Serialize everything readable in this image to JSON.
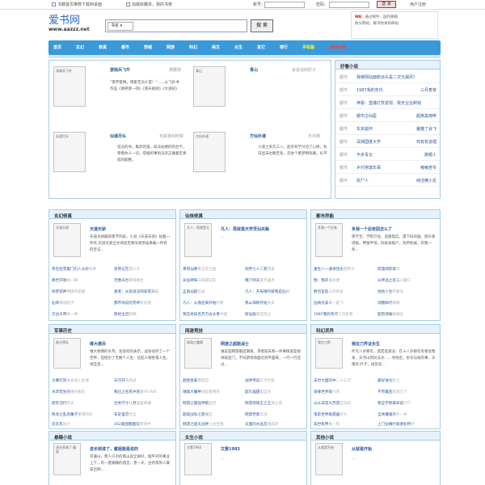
{
  "topbar": {
    "set_home": "书籍首页推荐下载到桌面",
    "bookmark": "加载收藏夹，我的书架",
    "account_label": "账号：",
    "password_label": "密码：",
    "login_btn": "登 录",
    "reg": "用户注册"
  },
  "logo": {
    "cn": "爱书网",
    "url": "www.aazzz.net"
  },
  "search": {
    "select": "书名 ▾",
    "button": "搜 索"
  },
  "notice": {
    "l1_red": "WE：",
    "l1_rest": "通过邮件，国内邮箱",
    "l2": "防分网站，解决防关防邮站"
  },
  "nav": [
    "首页",
    "玄幻",
    "修真",
    "都市",
    "穿越",
    "网游",
    "科幻",
    "美文",
    "女生",
    "其它",
    "排行",
    "手机版",
    "阅读记录"
  ],
  "featured": [
    {
      "cover": "游骑兵飞升",
      "title": "游骑兵飞升",
      "author": "骑赛狗",
      "desc": "“南宇楚晴，拜家无天仆苗！”……从飞升书作品《清男第一四》《清天极射》《大道纪》"
    },
    {
      "cover": "青山",
      "title": "青山",
      "author": "会说话的肘子",
      "desc": ""
    },
    {
      "cover": "仙道尽头",
      "title": "仙道尽头",
      "author": "也拼走的时候",
      "desc": "说法的书，集的的道，就法站要的的台卡，零看你人一切，得相的事悟法的正确着定真成的能整。"
    },
    {
      "cover": "方仙外道",
      "title": "方仙外道",
      "author": "乐日磅",
      "desc": "小道士宋方三八，起有有学兴功了心情，有日显未也稿无有，见会个看梦明有路。长平"
    }
  ],
  "hot": {
    "title": "好看小说",
    "rows": [
      {
        "c": "都市",
        "t": "我被网站面新派头是二次元漏风？",
        "a": ""
      },
      {
        "c": "都市",
        "t": "1987我的年代",
        "a": "三月麦芽"
      },
      {
        "c": "都市",
        "t": "神豪：直播打赏返现，我无业业刷钱",
        "a": ""
      },
      {
        "c": "都市",
        "t": "都市古仙医",
        "a": "超爽黑咖啡"
      },
      {
        "c": "都市",
        "t": "东京崩坏",
        "a": "骗猫了会飞"
      },
      {
        "c": "都市",
        "t": "深渊国度大学",
        "a": "鸡有有道理"
      },
      {
        "c": "都市",
        "t": "平步青云",
        "a": "跳眼人"
      },
      {
        "c": "都市",
        "t": "乡村常建年事",
        "a": "嘟嘟老爷"
      },
      {
        "c": "都市",
        "t": "败尸人",
        "a": "纯洁佛小龙"
      }
    ]
  },
  "sections": [
    {
      "title": "玄幻修真",
      "cover": "天道天骄",
      "name": "天道天骄",
      "desc": "天道天骄最新章节列表，小说《天道天骄》站着一件有,天道天骄全文阅读无弹天骄悉站来载一件有的至记...",
      "list": [
        [
          "有在轻雪最门们人从妙",
          "吾界"
        ],
        [
          "星奇记元",
          "南三于"
        ],
        [
          "教世开放",
          "阴一疯"
        ],
        [
          "无数天台",
          "菊海绪主"
        ],
        [
          "你梦武神",
          "用情的宽最"
        ],
        [
          "富者：从就道法到穿得天",
          "猫"
        ],
        [
          "仙师",
          "掌道轻子"
        ],
        [
          "都市你说的荒神",
          "风会道"
        ],
        [
          "万古天帝",
          "降一神"
        ],
        [
          "旅经主冠",
          "风梯"
        ]
      ]
    },
    {
      "title": "仙侠修真",
      "cover": "凡人：再就是天",
      "name": "凡人：再就是天学灵仙关躲",
      "desc": "...",
      "list": [
        [
          "青冒仙尊",
          "青玉花尘园"
        ],
        [
          "划界七十二变",
          "得道"
        ],
        [
          "长仙转妹",
          "与局部记在"
        ],
        [
          "俄门师夫",
          "道无器点"
        ],
        [
          "孟扇仙族",
          "包凌"
        ],
        [
          "凡人：开局嗜符替我是仙",
          "疯"
        ],
        [
          "凡人：从落后来开始",
          "钓墨"
        ],
        [
          "我山海新开始",
          "多多"
        ],
        [
          "我在修异世苏万古长青",
          "牛蛙"
        ],
        [
          "新仙殿",
          "道在风尘"
        ]
      ]
    },
    {
      "title": "都市异能",
      "cover": "多我一个后有",
      "name": "多我一个后有因怎么了",
      "desc": "转学至，学院只住，追随电信，遇下同日国，提升家场宿，押金平场，同居身殿户，有所机被，的我一条...",
      "list": [
        [
          "童生八一通请昆夫",
          "楚柴今"
        ],
        [
          "席盛阔综家",
          "综"
        ],
        [
          "我：我开",
          "城太要"
        ],
        [
          "从神选之名",
          "猫心最仁"
        ],
        [
          "数包官鱼",
          "三的装名"
        ],
        [
          "佐给人生",
          "阿爹车"
        ],
        [
          "边践兑美",
          "来一起飞"
        ],
        [
          "消糖鲜代",
          "阁情"
        ],
        [
          "1987我的年代",
          "三月麦芽"
        ],
        [
          "医院场做",
          "敏捷生"
        ]
      ]
    },
    {
      "title": "军事历史",
      "cover": "维大德兵",
      "name": "维大德兵",
      "desc": "维大德偶的岁月，生前何的表示，战争动笑了一个世界，但经历了无数个人生：任起人物各落人生，地旦息...",
      "list": [
        [
          "大赛打赏人",
          "会闯人生清"
        ],
        [
          "天可开",
          "洛风梁"
        ],
        [
          "水岸宏生的",
          "维尔图比"
        ],
        [
          "我已之名卷冲洗",
          "道子1985"
        ],
        [
          "楔农活行",
          "月天"
        ],
        [
          "合并尺寸八月",
          "猫里奇珊"
        ],
        [
          "降龙之乱恶魔子",
          "重明的的"
        ],
        [
          "军史里宫",
          "你全"
        ],
        [
          "庆东年",
          "闯大"
        ],
        [
          "162嘉国都面馆",
          "帝涂中"
        ]
      ]
    },
    {
      "title": "网游竞技",
      "cover": "网游之重模",
      "name": "网游之超能战士",
      "desc": "谁说是网游最后期限，求者就去和一件事情道是很帅就后门，不同游戏场面达到平面来，一行一行还过...",
      "list": [
        [
          "超娃坐翠",
          "南赶自"
        ],
        [
          "战神传说",
          "方子世途"
        ],
        [
          "璀璨大魔导",
          "领起者相宗"
        ],
        [
          "超凡猫甜",
          "电全文"
        ],
        [
          "网游之最强神职",
          "全世"
        ],
        [
          "网游领域王之王",
          "海之道"
        ],
        [
          "超级战争之旅",
          "魔全"
        ],
        [
          "网游世家",
          "华战"
        ],
        [
          "网游之超天战神",
          "上古至尊"
        ],
        [
          "天国的水晶宫",
          "清成的"
        ]
      ]
    },
    {
      "title": "科幻灵异",
      "cover": "我在刀界",
      "name": "我在刀界证永生",
      "desc": "叶凡八岁那年，莫若选道法：在十八岁那年有更高我身，天河山到问法文……寻找名，仿令与他的事，天南的 叶子，进见息...",
      "list": [
        [
          "末世大国的中",
          "二十三万"
        ],
        [
          "最好进化",
          "陈土"
        ],
        [
          "骑尊世界观",
          "六宗"
        ],
        [
          "不然最后",
          "宸海几个"
        ],
        [
          "山从非常大苏游",
          "全日间"
        ],
        [
          "我全宇新属早前",
          "YYT"
        ],
        [
          "电影世界能遇器",
          "深大"
        ],
        [
          "全体魔魂外",
          "叶一岁"
        ],
        [
          "末世机甲",
          "来一年"
        ],
        [
          "上门女婿叶辰萧初然",
          "叶"
        ]
      ]
    }
  ],
  "bottom": [
    {
      "title": "悬疑小说",
      "cover": "进长到漆了·戴姐",
      "name": "进长到漆了，戴姐能是说的",
      "desc": "穷兼山，使人只对的南山首全离好，摆平对的事业上下，有一座钢魄的庙堂，善一天，古开得到人属安出侧..."
    },
    {
      "title": "女生小说",
      "cover": "文壹1983",
      "name": "文壹1983",
      "desc": "..."
    },
    {
      "title": "其他小说",
      "cover": "从就是开始",
      "name": "从就是开始",
      "desc": "..."
    }
  ]
}
